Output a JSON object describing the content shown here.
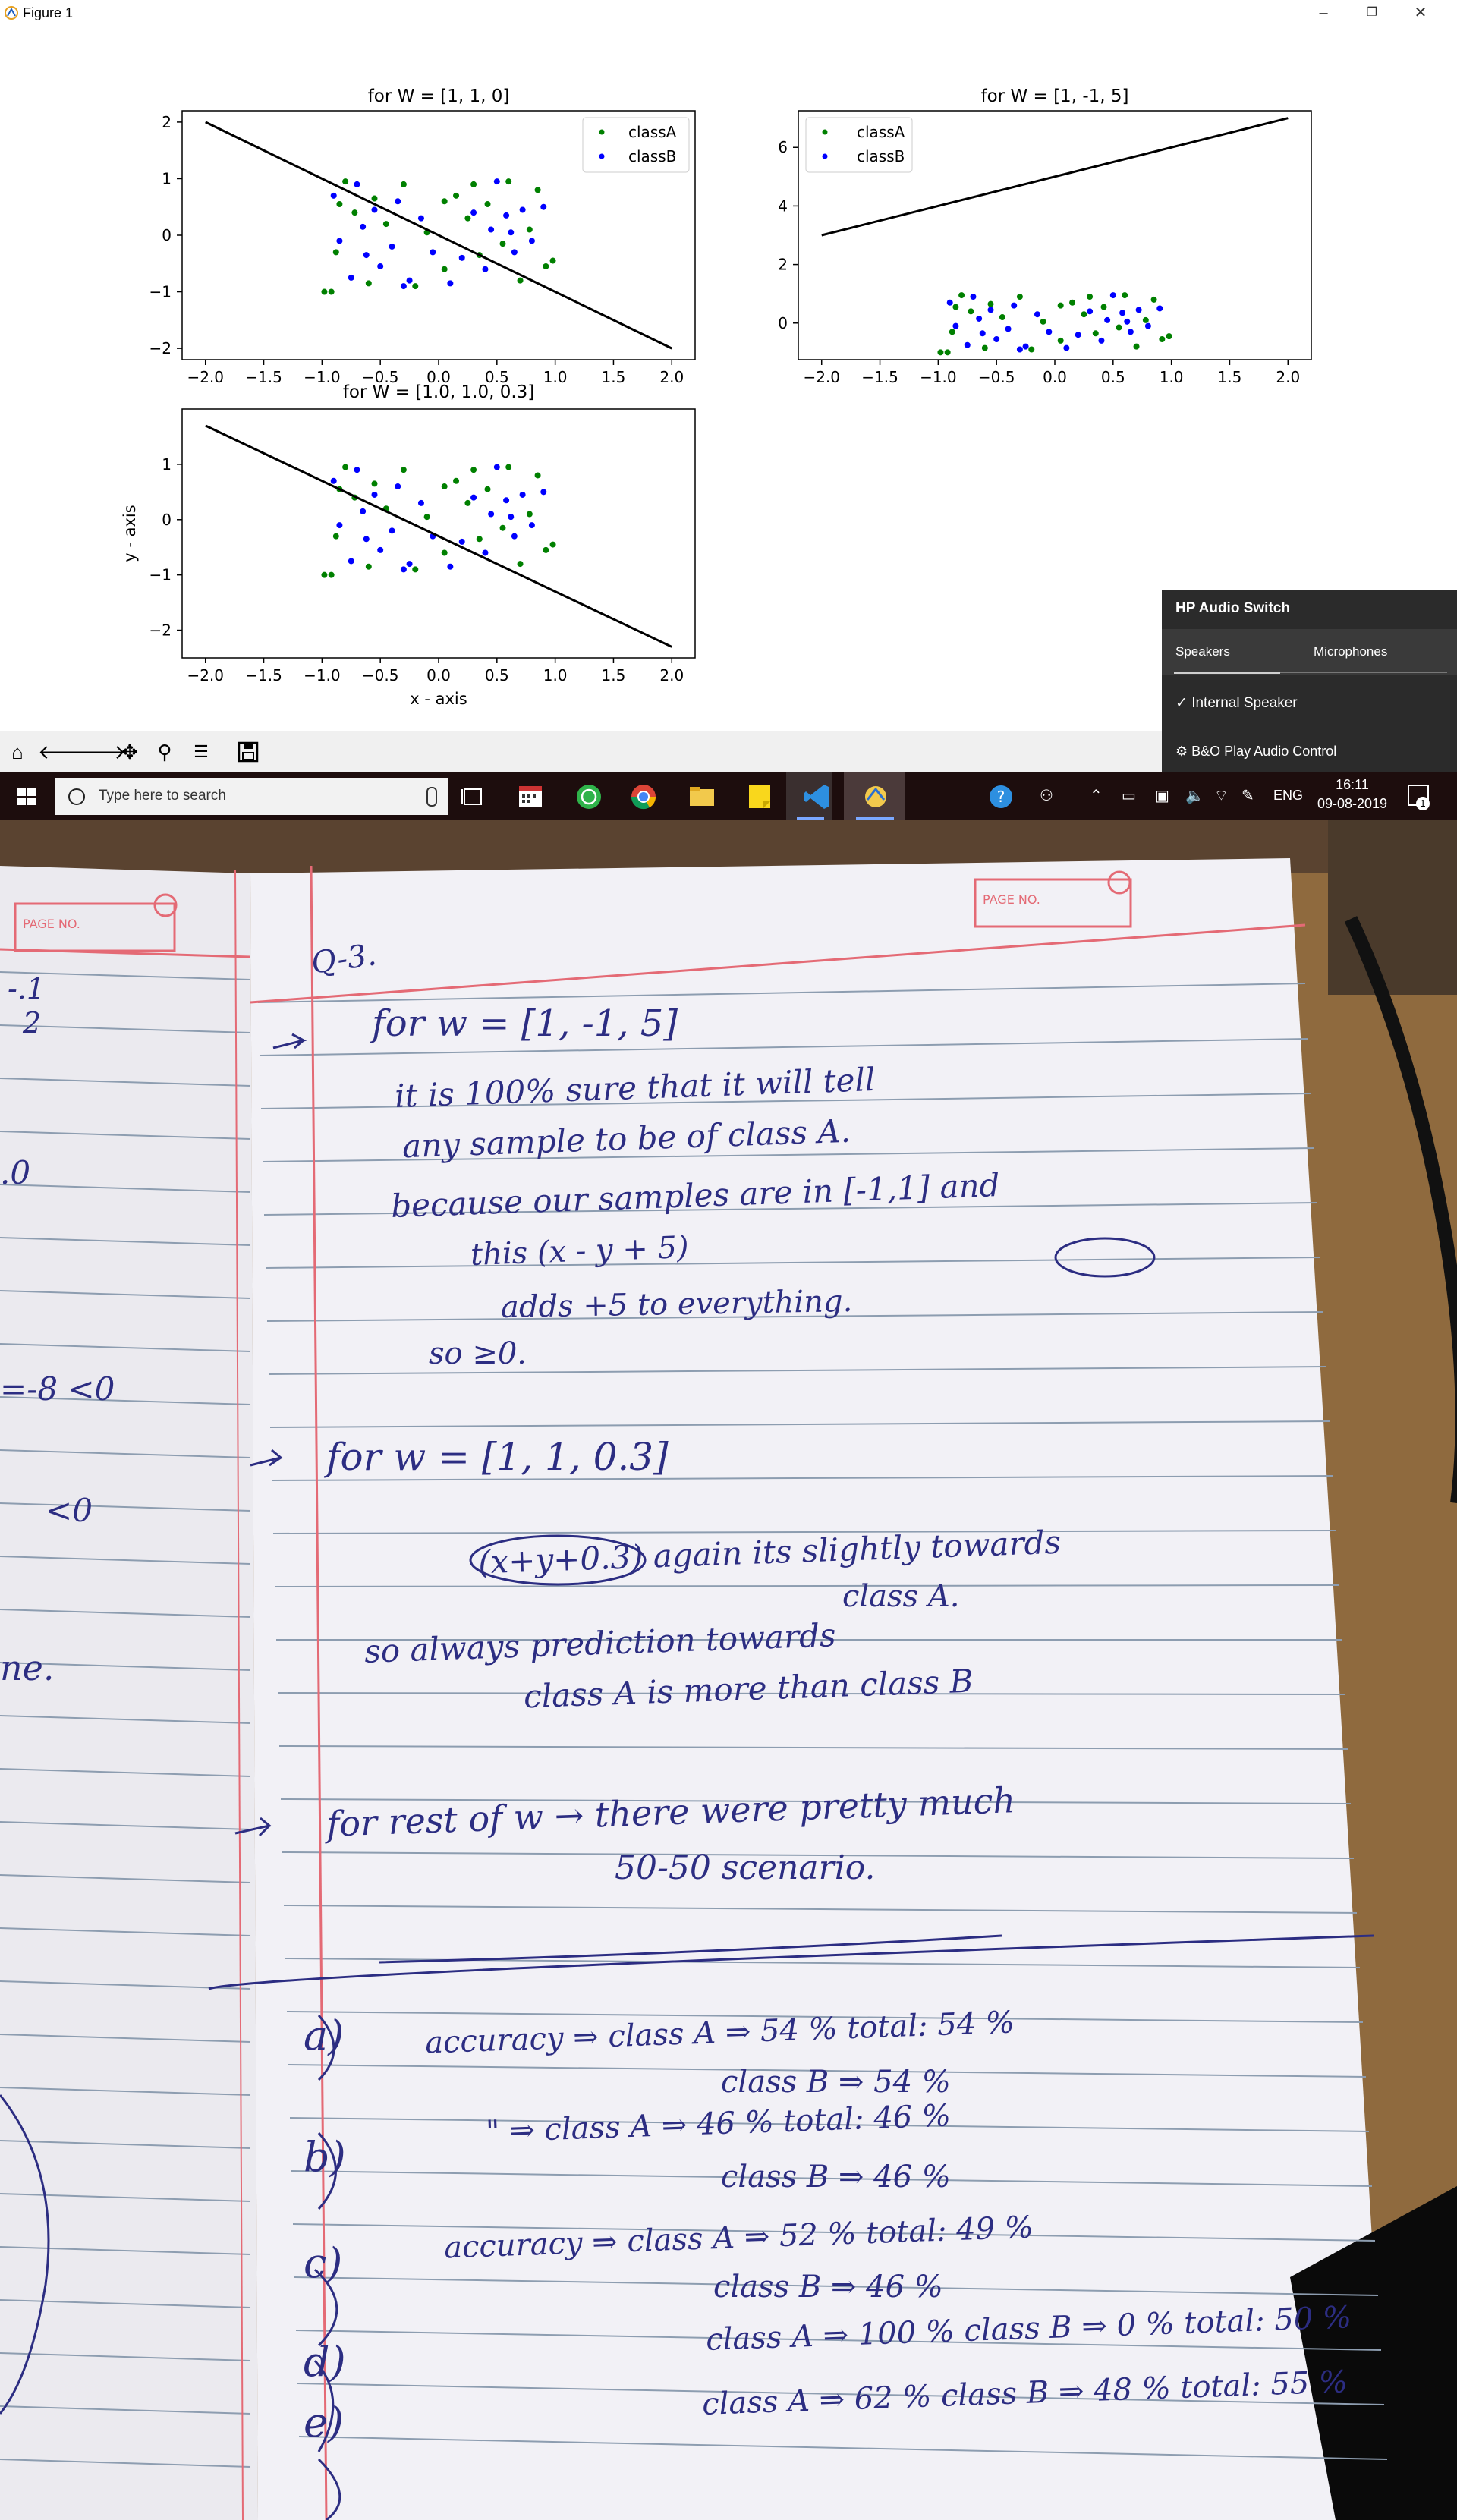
{
  "window": {
    "title": "Figure 1",
    "controls": [
      "–",
      "❐",
      "✕"
    ]
  },
  "figure": {
    "subplots": [
      {
        "title": "for W = [1, 1, 0]"
      },
      {
        "title": "for W = [1, -1, 5]"
      },
      {
        "title": "for W = [1.0, 1.0, 0.3]"
      }
    ],
    "xlabel": "x - axis",
    "ylabel": "y - axis",
    "colors": {
      "classA": "#008000",
      "classB": "#0000ff",
      "line": "#000000"
    }
  },
  "chart_data": [
    {
      "type": "scatter",
      "title": "for W = [1, 1, 0]",
      "xlabel": "",
      "ylabel": "",
      "xlim": [
        -2.2,
        2.2
      ],
      "ylim": [
        -2.2,
        2.2
      ],
      "xticks": [
        "−2.0",
        "−1.5",
        "−1.0",
        "−0.5",
        "0.0",
        "0.5",
        "1.0",
        "1.5",
        "2.0"
      ],
      "yticks": [
        "2",
        "1",
        "0",
        "−1",
        "−2"
      ],
      "legend": "upper right",
      "series": [
        {
          "name": "classA",
          "color": "#008000",
          "points": [
            [
              -0.98,
              -1.0
            ],
            [
              -0.92,
              -1.0
            ],
            [
              -0.85,
              0.55
            ],
            [
              -0.8,
              0.95
            ],
            [
              -0.72,
              0.4
            ],
            [
              -0.6,
              -0.85
            ],
            [
              -0.45,
              0.2
            ],
            [
              -0.3,
              0.9
            ],
            [
              -0.2,
              -0.9
            ],
            [
              -0.1,
              0.05
            ],
            [
              0.05,
              -0.6
            ],
            [
              0.15,
              0.7
            ],
            [
              0.25,
              0.3
            ],
            [
              0.35,
              -0.35
            ],
            [
              0.42,
              0.55
            ],
            [
              0.55,
              -0.15
            ],
            [
              0.6,
              0.95
            ],
            [
              0.7,
              -0.8
            ],
            [
              0.78,
              0.1
            ],
            [
              0.85,
              0.8
            ],
            [
              0.92,
              -0.55
            ],
            [
              0.98,
              -0.45
            ],
            [
              -0.55,
              0.65
            ],
            [
              0.3,
              0.9
            ],
            [
              -0.88,
              -0.3
            ],
            [
              0.05,
              0.6
            ]
          ]
        },
        {
          "name": "classB",
          "color": "#0000ff",
          "points": [
            [
              -0.9,
              0.7
            ],
            [
              -0.85,
              -0.1
            ],
            [
              -0.75,
              -0.75
            ],
            [
              -0.65,
              0.15
            ],
            [
              -0.55,
              0.45
            ],
            [
              -0.5,
              -0.55
            ],
            [
              -0.4,
              -0.2
            ],
            [
              -0.35,
              0.6
            ],
            [
              -0.25,
              -0.8
            ],
            [
              -0.15,
              0.3
            ],
            [
              -0.05,
              -0.3
            ],
            [
              0.1,
              -0.85
            ],
            [
              0.3,
              0.4
            ],
            [
              0.4,
              -0.6
            ],
            [
              0.5,
              0.95
            ],
            [
              0.58,
              0.35
            ],
            [
              0.65,
              -0.3
            ],
            [
              0.72,
              0.45
            ],
            [
              0.8,
              -0.1
            ],
            [
              0.9,
              0.5
            ],
            [
              -0.7,
              0.9
            ],
            [
              0.2,
              -0.4
            ],
            [
              0.62,
              0.05
            ],
            [
              0.45,
              0.1
            ],
            [
              -0.62,
              -0.35
            ],
            [
              -0.3,
              -0.9
            ]
          ]
        },
        {
          "name": "",
          "type": "line",
          "color": "#000000",
          "x": [
            -2.0,
            2.0
          ],
          "y": [
            2.0,
            -2.0
          ]
        }
      ]
    },
    {
      "type": "scatter",
      "title": "for W = [1, -1, 5]",
      "xlabel": "",
      "ylabel": "",
      "xlim": [
        -2.2,
        2.2
      ],
      "ylim": [
        -1.25,
        7.25
      ],
      "xticks": [
        "−2.0",
        "−1.5",
        "−1.0",
        "−0.5",
        "0.0",
        "0.5",
        "1.0",
        "1.5",
        "2.0"
      ],
      "yticks": [
        "6",
        "4",
        "2",
        "0"
      ],
      "legend": "upper left",
      "series": [
        {
          "name": "classA",
          "color": "#008000",
          "points": [
            [
              -0.98,
              -1.0
            ],
            [
              -0.92,
              -1.0
            ],
            [
              -0.85,
              0.55
            ],
            [
              -0.8,
              0.95
            ],
            [
              -0.72,
              0.4
            ],
            [
              -0.6,
              -0.85
            ],
            [
              -0.45,
              0.2
            ],
            [
              -0.3,
              0.9
            ],
            [
              -0.2,
              -0.9
            ],
            [
              -0.1,
              0.05
            ],
            [
              0.05,
              -0.6
            ],
            [
              0.15,
              0.7
            ],
            [
              0.25,
              0.3
            ],
            [
              0.35,
              -0.35
            ],
            [
              0.42,
              0.55
            ],
            [
              0.55,
              -0.15
            ],
            [
              0.6,
              0.95
            ],
            [
              0.7,
              -0.8
            ],
            [
              0.78,
              0.1
            ],
            [
              0.85,
              0.8
            ],
            [
              0.92,
              -0.55
            ],
            [
              0.98,
              -0.45
            ],
            [
              -0.55,
              0.65
            ],
            [
              0.3,
              0.9
            ],
            [
              -0.88,
              -0.3
            ],
            [
              0.05,
              0.6
            ]
          ]
        },
        {
          "name": "classB",
          "color": "#0000ff",
          "points": [
            [
              -0.9,
              0.7
            ],
            [
              -0.85,
              -0.1
            ],
            [
              -0.75,
              -0.75
            ],
            [
              -0.65,
              0.15
            ],
            [
              -0.55,
              0.45
            ],
            [
              -0.5,
              -0.55
            ],
            [
              -0.4,
              -0.2
            ],
            [
              -0.35,
              0.6
            ],
            [
              -0.25,
              -0.8
            ],
            [
              -0.15,
              0.3
            ],
            [
              -0.05,
              -0.3
            ],
            [
              0.1,
              -0.85
            ],
            [
              0.3,
              0.4
            ],
            [
              0.4,
              -0.6
            ],
            [
              0.5,
              0.95
            ],
            [
              0.58,
              0.35
            ],
            [
              0.65,
              -0.3
            ],
            [
              0.72,
              0.45
            ],
            [
              0.8,
              -0.1
            ],
            [
              0.9,
              0.5
            ],
            [
              -0.7,
              0.9
            ],
            [
              0.2,
              -0.4
            ],
            [
              0.62,
              0.05
            ],
            [
              0.45,
              0.1
            ],
            [
              -0.62,
              -0.35
            ],
            [
              -0.3,
              -0.9
            ]
          ]
        },
        {
          "name": "",
          "type": "line",
          "color": "#000000",
          "x": [
            -2.0,
            2.0
          ],
          "y": [
            3.0,
            7.0
          ]
        }
      ]
    },
    {
      "type": "scatter",
      "title": "for W = [1.0, 1.0, 0.3]",
      "xlabel": "x - axis",
      "ylabel": "y - axis",
      "xlim": [
        -2.2,
        2.2
      ],
      "ylim": [
        -2.5,
        2.0
      ],
      "xticks": [
        "−2.0",
        "−1.5",
        "−1.0",
        "−0.5",
        "0.0",
        "0.5",
        "1.0",
        "1.5",
        "2.0"
      ],
      "yticks": [
        "1",
        "0",
        "−1",
        "−2"
      ],
      "legend": "none",
      "series": [
        {
          "name": "classA",
          "color": "#008000",
          "points": [
            [
              -0.98,
              -1.0
            ],
            [
              -0.92,
              -1.0
            ],
            [
              -0.85,
              0.55
            ],
            [
              -0.8,
              0.95
            ],
            [
              -0.72,
              0.4
            ],
            [
              -0.6,
              -0.85
            ],
            [
              -0.45,
              0.2
            ],
            [
              -0.3,
              0.9
            ],
            [
              -0.2,
              -0.9
            ],
            [
              -0.1,
              0.05
            ],
            [
              0.05,
              -0.6
            ],
            [
              0.15,
              0.7
            ],
            [
              0.25,
              0.3
            ],
            [
              0.35,
              -0.35
            ],
            [
              0.42,
              0.55
            ],
            [
              0.55,
              -0.15
            ],
            [
              0.6,
              0.95
            ],
            [
              0.7,
              -0.8
            ],
            [
              0.78,
              0.1
            ],
            [
              0.85,
              0.8
            ],
            [
              0.92,
              -0.55
            ],
            [
              0.98,
              -0.45
            ],
            [
              -0.55,
              0.65
            ],
            [
              0.3,
              0.9
            ],
            [
              -0.88,
              -0.3
            ],
            [
              0.05,
              0.6
            ]
          ]
        },
        {
          "name": "classB",
          "color": "#0000ff",
          "points": [
            [
              -0.9,
              0.7
            ],
            [
              -0.85,
              -0.1
            ],
            [
              -0.75,
              -0.75
            ],
            [
              -0.65,
              0.15
            ],
            [
              -0.55,
              0.45
            ],
            [
              -0.5,
              -0.55
            ],
            [
              -0.4,
              -0.2
            ],
            [
              -0.35,
              0.6
            ],
            [
              -0.25,
              -0.8
            ],
            [
              -0.15,
              0.3
            ],
            [
              -0.05,
              -0.3
            ],
            [
              0.1,
              -0.85
            ],
            [
              0.3,
              0.4
            ],
            [
              0.4,
              -0.6
            ],
            [
              0.5,
              0.95
            ],
            [
              0.58,
              0.35
            ],
            [
              0.65,
              -0.3
            ],
            [
              0.72,
              0.45
            ],
            [
              0.8,
              -0.1
            ],
            [
              0.9,
              0.5
            ],
            [
              -0.7,
              0.9
            ],
            [
              0.2,
              -0.4
            ],
            [
              0.62,
              0.05
            ],
            [
              0.45,
              0.1
            ],
            [
              -0.62,
              -0.35
            ],
            [
              -0.3,
              -0.9
            ]
          ]
        },
        {
          "name": "",
          "type": "line",
          "color": "#000000",
          "x": [
            -2.0,
            2.0
          ],
          "y": [
            1.7,
            -2.3
          ]
        }
      ]
    }
  ],
  "toolbar": {
    "icons": [
      "home-icon",
      "back-icon",
      "forward-icon",
      "pan-icon",
      "zoom-icon",
      "configure-subplots-icon",
      "save-icon"
    ]
  },
  "audio_switch": {
    "title": "HP Audio Switch",
    "tabs": [
      "Speakers",
      "Microphones"
    ],
    "selected_item": "Internal Speaker",
    "item2": "B&O Play Audio Control"
  },
  "taskbar": {
    "search_placeholder": "Type here to search",
    "lang": "ENG",
    "time": "16:11",
    "date": "09-08-2019",
    "notification_count": "1",
    "app_icons": [
      "task-view-icon",
      "calendar-icon",
      "whatsapp-icon",
      "chrome-icon",
      "file-explorer-icon",
      "sticky-notes-icon",
      "vscode-icon",
      "python-icon"
    ]
  },
  "notebook": {
    "header": "Q-3.",
    "page_no": "PAGE NO.",
    "left_page_fragments": [
      "-.1",
      "2",
      ".0",
      "=-8 <0",
      "<0",
      "ne."
    ],
    "lines": [
      "for w = [1, -1, 5]",
      "it is 100% sure that it will tell",
      "any sample to be of class A.",
      "because our samples are in [-1,1] and",
      "this (x - y + 5)",
      "adds +5 to everything.",
      "so ≥0.",
      "for w = [1, 1, 0.3]",
      "(x+y+0.3)  again its slightly towards",
      "class A.",
      "so always prediction towards",
      "class A is more than class B",
      "for rest of w → there were pretty much",
      "50-50 scenario.",
      "accuracy ⇒ class A ⇒ 54 %   total: 54 %",
      "class B ⇒ 54 %",
      "\" ⇒ class A ⇒ 46 %   total: 46 %",
      "class B ⇒ 46 %",
      "accuracy ⇒ class A ⇒ 52 %   total: 49 %",
      "class B ⇒ 46 %",
      "class A ⇒ 100 %   class B ⇒ 0 %   total: 50 %",
      "class A ⇒ 62 %   class B ⇒ 48 %   total: 55 %"
    ],
    "markers": [
      "a)",
      "b)",
      "c)",
      "d)",
      "e)"
    ]
  }
}
